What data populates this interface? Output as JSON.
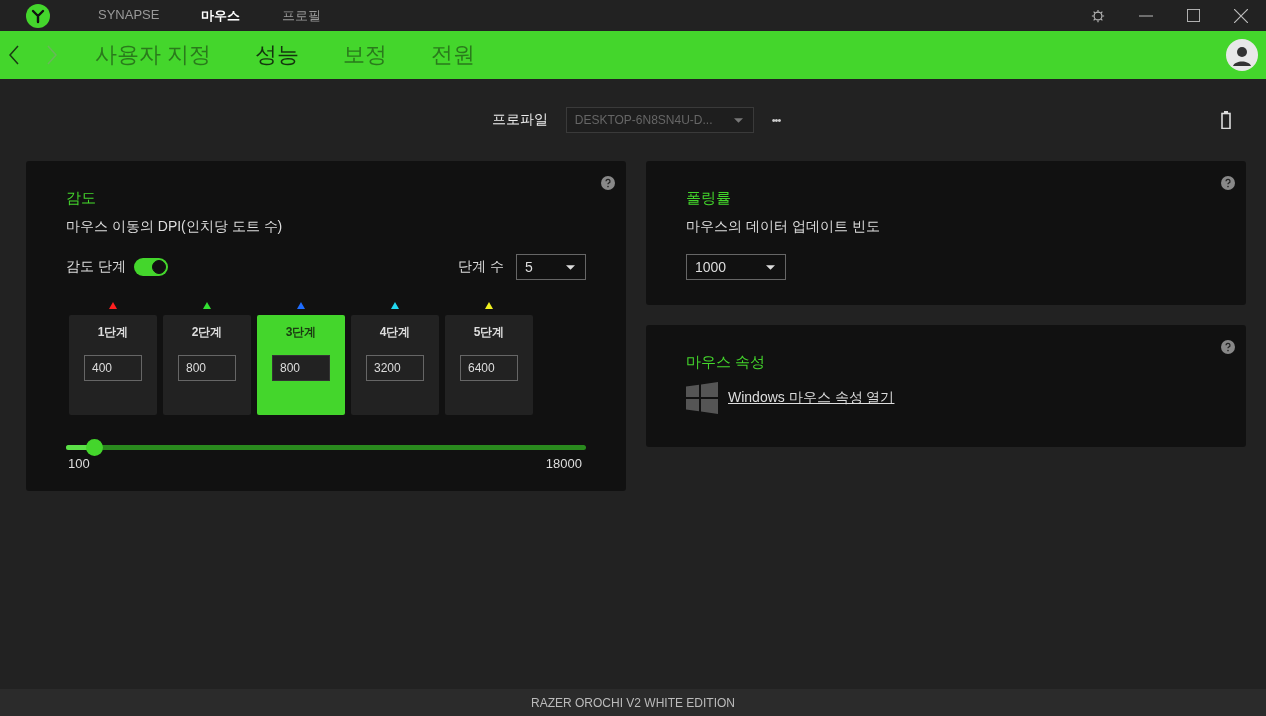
{
  "top_tabs": [
    {
      "label": "SYNAPSE",
      "selected": false
    },
    {
      "label": "마우스",
      "selected": true
    },
    {
      "label": "프로필",
      "selected": false
    }
  ],
  "sub_tabs": [
    {
      "label": "사용자 지정",
      "selected": false
    },
    {
      "label": "성능",
      "selected": true
    },
    {
      "label": "보정",
      "selected": false
    },
    {
      "label": "전원",
      "selected": false
    }
  ],
  "profile": {
    "label": "프로파일",
    "value": "DESKTOP-6N8SN4U-D...",
    "more": "•••"
  },
  "sensitivity": {
    "title": "감도",
    "description": "마우스 이동의 DPI(인치당 도트 수)",
    "stages_label": "감도 단계",
    "stages_on": true,
    "count_label": "단계 수",
    "count": "5",
    "stages": [
      {
        "label": "1단계",
        "value": "400",
        "color": "#ff2020",
        "selected": false
      },
      {
        "label": "2단계",
        "value": "800",
        "color": "#33e033",
        "selected": false
      },
      {
        "label": "3단계",
        "value": "800",
        "color": "#1e6cff",
        "selected": true
      },
      {
        "label": "4단계",
        "value": "3200",
        "color": "#22d8f0",
        "selected": false
      },
      {
        "label": "5단계",
        "value": "6400",
        "color": "#f0f020",
        "selected": false
      }
    ],
    "slider": {
      "level": 0.053,
      "min": "100",
      "max": "18000"
    }
  },
  "polling": {
    "title": "폴링률",
    "description": "마우스의 데이터 업데이트 빈도",
    "value": "1000"
  },
  "mouse_props": {
    "title": "마우스 속성",
    "link": "Windows 마우스 속성 열기"
  },
  "status_bar": "RAZER OROCHI V2 WHITE EDITION"
}
